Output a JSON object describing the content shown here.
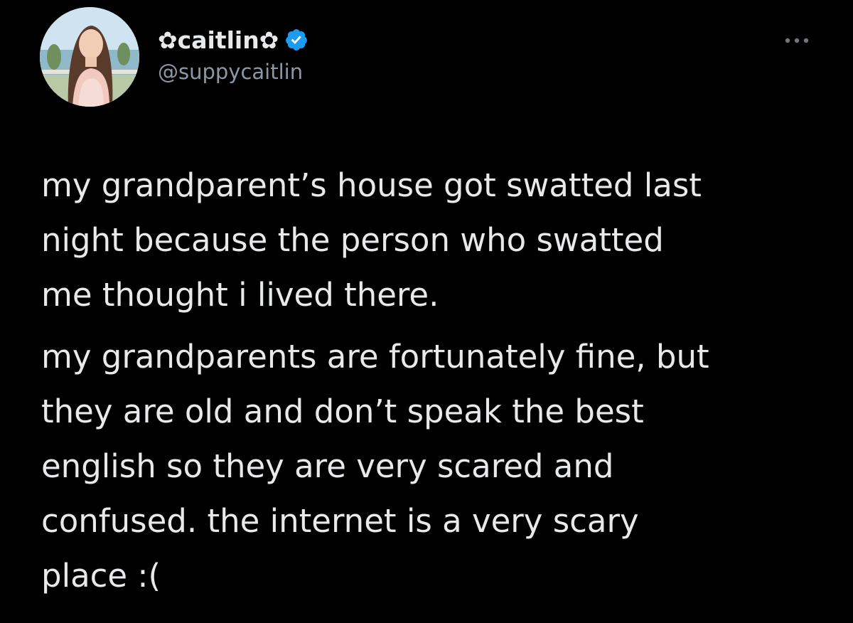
{
  "author": {
    "display_name": "✿caitlin✿",
    "handle": "@suppycaitlin",
    "verified": true,
    "avatar": "profile-photo"
  },
  "menu": {
    "icon": "more-options-icon"
  },
  "tweet": {
    "paragraphs": [
      "my grandparent’s house got swatted last\nnight because the person who swatted\nme thought i lived there.",
      "my grandparents are fortunately fine, but\nthey are old and don’t speak the best\nenglish so they are very scared and\nconfused. the internet is a very scary\nplace :("
    ]
  },
  "colors": {
    "background": "#000000",
    "text_primary": "#e7e9ea",
    "text_secondary": "#8b98a5",
    "verified": "#1d9bf0"
  }
}
